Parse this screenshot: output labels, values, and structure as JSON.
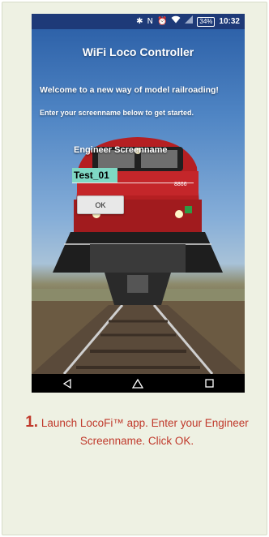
{
  "status_bar": {
    "icons": [
      "bluetooth-icon",
      "nfc-icon",
      "alarm-icon",
      "wifi-icon",
      "signal-icon"
    ],
    "battery": "34%",
    "time": "10:32"
  },
  "app": {
    "title": "WiFi Loco Controller",
    "welcome": "Welcome to a new way of model railroading!",
    "instructions": "Enter your screenname below to get started.",
    "field_label": "Engineer Screenname",
    "field_value": "Test_01",
    "ok_label": "OK",
    "locomotive_number": "8866"
  },
  "nav_bar": {
    "items": [
      "back-icon",
      "home-icon",
      "recents-icon"
    ]
  },
  "caption": {
    "step": "1.",
    "text": "Launch LocoFi™ app. Enter your Engineer Screenname. Click OK."
  },
  "colors": {
    "status_bar": "#1e3a78",
    "card_background": "#eef1e3",
    "caption_text": "#c0392b",
    "input_highlight": "#7fd8c4",
    "locomotive_red": "#b51f22"
  }
}
